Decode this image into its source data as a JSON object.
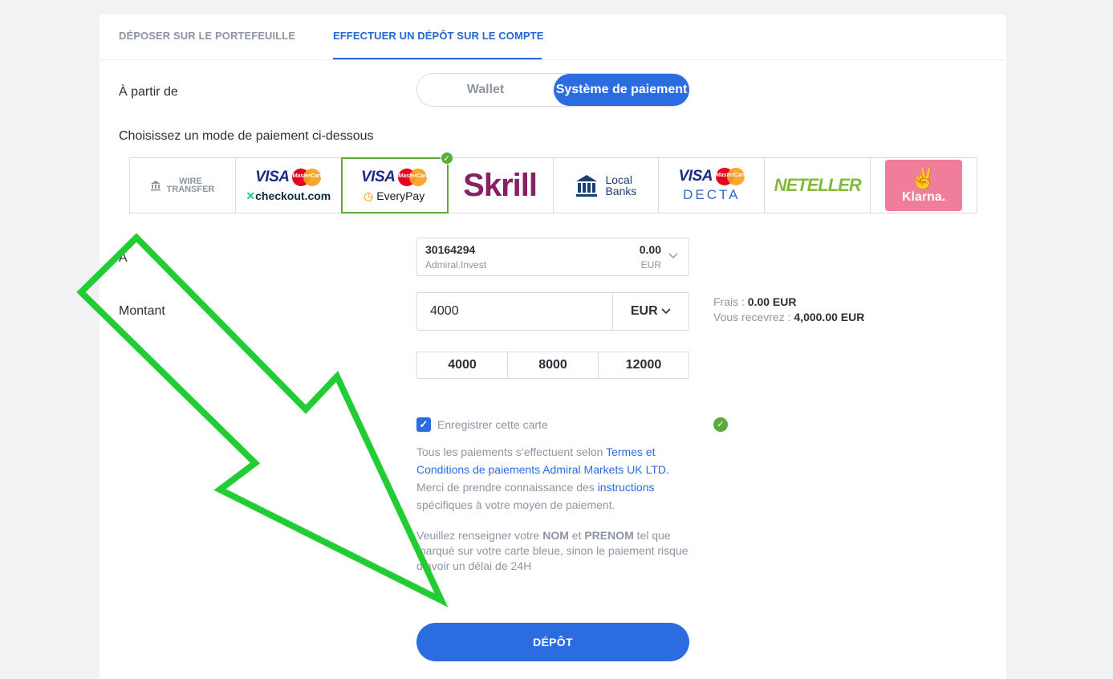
{
  "tabs": [
    {
      "label": "DÉPOSER SUR LE PORTEFEUILLE",
      "active": false
    },
    {
      "label": "EFFECTUER UN DÉPÔT SUR LE COMPTE",
      "active": true
    }
  ],
  "from": {
    "label": "À partir de",
    "options": [
      "Wallet",
      "Système de paiement"
    ],
    "selected": "Système de paiement"
  },
  "methods": {
    "heading": "Choisissez un mode de paiement ci-dessous",
    "selected_index": 2,
    "wire_line1": "WIRE",
    "wire_line2": "TRANSFER",
    "visa": "VISA",
    "mastercard": "MasterCard",
    "checkout": "checkout.com",
    "everypay": "EveryPay",
    "skrill": "Skrill",
    "local_line1": "Local",
    "local_line2": "Banks",
    "decta": "DECTA",
    "neteller": "NETELLER",
    "klarna": "Klarna."
  },
  "to": {
    "label": "À",
    "account_number": "30164294",
    "account_name": "Admiral.Invest",
    "balance": "0.00",
    "currency": "EUR"
  },
  "amount": {
    "label": "Montant",
    "value": "4000",
    "currency": "EUR",
    "fees_label": "Frais : ",
    "fees_value": "0.00 EUR",
    "receive_label": "Vous recevrez : ",
    "receive_value": "4,000.00 EUR",
    "quick": [
      "4000",
      "8000",
      "12000"
    ]
  },
  "save_card": {
    "label": "Enregistrer cette carte",
    "checked": true
  },
  "terms": {
    "t1": "Tous les paiements s’effectuent selon ",
    "link1": "Termes et Conditions de paiements Admiral Markets UK LTD.",
    "t2": " Merci de prendre connaissance des ",
    "link2": "instructions",
    "t3": " spécifiques à votre moyen de paiement."
  },
  "notice": {
    "n1": "Veuillez renseigner votre ",
    "nom": "NOM",
    "n2": " et ",
    "prenom": "PRENOM",
    "n3": " tel que marqué sur votre carte bleue, sinon le paiement risque d’avoir un délai de 24H"
  },
  "deposit_button": "DÉPÔT",
  "colors": {
    "accent": "#2b6de0",
    "success": "#5bab3b",
    "arrow": "#22cc33"
  }
}
